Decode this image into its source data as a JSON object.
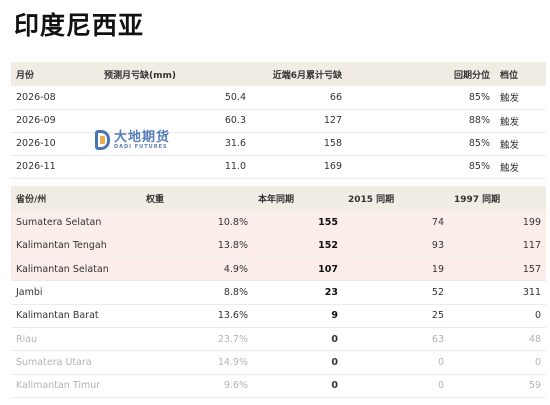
{
  "title": "印度尼西亚",
  "forecast": {
    "headers": [
      "月份",
      "预测月亏缺(mm)",
      "近端6月累计亏缺",
      "回期分位",
      "档位"
    ],
    "rows": [
      {
        "month": "2026-08",
        "deficit": "50.4",
        "cum": "66",
        "pct": "85%",
        "level": "触发"
      },
      {
        "month": "2026-09",
        "deficit": "60.3",
        "cum": "127",
        "pct": "88%",
        "level": "触发"
      },
      {
        "month": "2026-10",
        "deficit": "31.6",
        "cum": "158",
        "pct": "85%",
        "level": "触发"
      },
      {
        "month": "2026-11",
        "deficit": "11.0",
        "cum": "169",
        "pct": "85%",
        "level": "触发"
      }
    ]
  },
  "provinces": {
    "headers": [
      "省份/州",
      "权重",
      "本年同期",
      "2015 同期",
      "1997 同期"
    ],
    "rows": [
      {
        "name": "Sumatera Selatan",
        "weight": "10.8%",
        "cur": "155",
        "y2015": "74",
        "y1997": "199"
      },
      {
        "name": "Kalimantan Tengah",
        "weight": "13.8%",
        "cur": "152",
        "y2015": "93",
        "y1997": "117"
      },
      {
        "name": "Kalimantan Selatan",
        "weight": "4.9%",
        "cur": "107",
        "y2015": "19",
        "y1997": "157"
      },
      {
        "name": "Jambi",
        "weight": "8.8%",
        "cur": "23",
        "y2015": "52",
        "y1997": "311"
      },
      {
        "name": "Kalimantan Barat",
        "weight": "13.6%",
        "cur": "9",
        "y2015": "25",
        "y1997": "0"
      },
      {
        "name": "Riau",
        "weight": "23.7%",
        "cur": "0",
        "y2015": "63",
        "y1997": "48"
      },
      {
        "name": "Sumatera Utara",
        "weight": "14.9%",
        "cur": "0",
        "y2015": "0",
        "y1997": "0"
      },
      {
        "name": "Kalimantan Timur",
        "weight": "9.6%",
        "cur": "0",
        "y2015": "0",
        "y1997": "59"
      }
    ]
  },
  "watermark": {
    "cn": "大地期货",
    "en": "DADI FUTURES"
  },
  "colors": {
    "header_bg": "#f1ede4",
    "highlight_bg": "#fbeeea",
    "logo_blue": "#2b5fa8"
  }
}
